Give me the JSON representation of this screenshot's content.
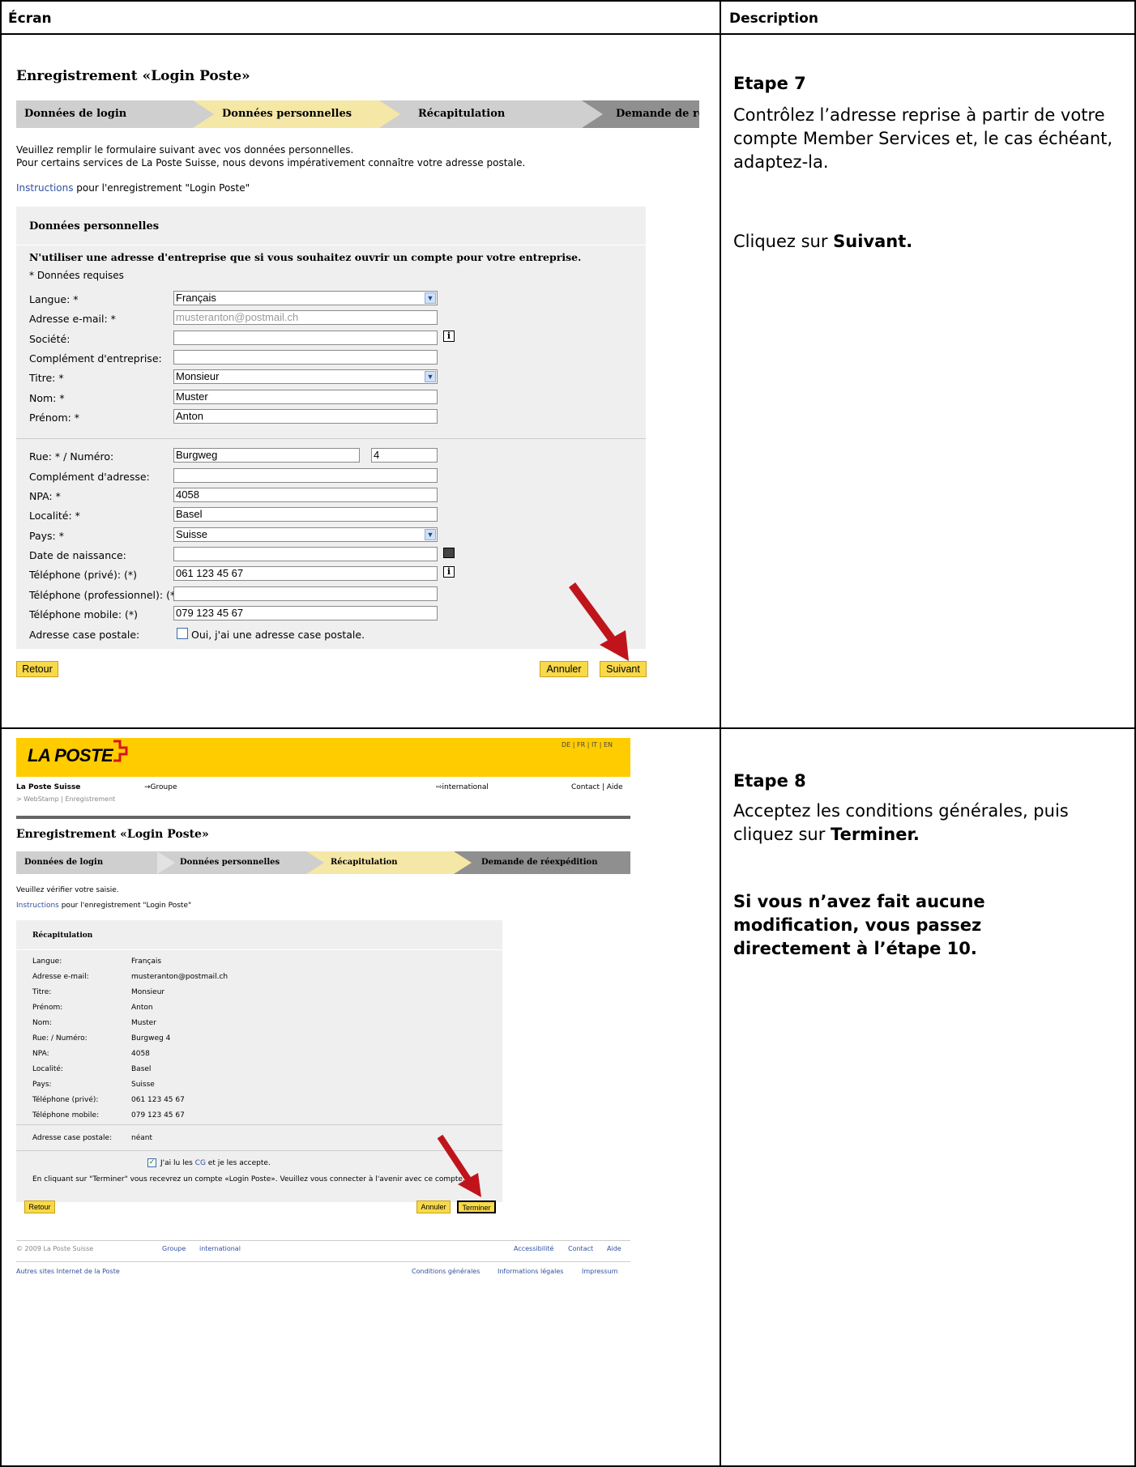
{
  "table": {
    "col_screen": "Écran",
    "col_description": "Description"
  },
  "step7": {
    "form_title": "Enregistrement «Login Poste»",
    "steps": [
      "Données de login",
      "Données personnelles",
      "Récapitulation",
      "Demande de réexpédition"
    ],
    "intro_line1": "Veuillez remplir le formulaire suivant avec vos données personnelles.",
    "intro_line2": "Pour certains services de La Poste Suisse, nous devons impérativement connaître votre adresse postale.",
    "instructions_link": "Instructions",
    "instructions_rest": " pour l'enregistrement \"Login Poste\"",
    "panel_title": "Données personnelles",
    "warning": "N'utiliser une adresse d'entreprise que si vous souhaitez ouvrir un compte pour votre entreprise.",
    "required_note": "* Données requises",
    "fields": [
      {
        "label": "Langue: *",
        "value": "Français"
      },
      {
        "label": "Adresse e-mail: *",
        "value": "musteranton@postmail.ch"
      },
      {
        "label": "Société:",
        "value": ""
      },
      {
        "label": "Complément d'entreprise:",
        "value": ""
      },
      {
        "label": "Titre: *",
        "value": "Monsieur"
      },
      {
        "label": "Nom: *",
        "value": "Muster"
      },
      {
        "label": "Prénom: *",
        "value": "Anton"
      }
    ],
    "address": [
      {
        "label": "Rue: * / Numéro:",
        "value": "Burgweg",
        "number": "4"
      },
      {
        "label": "Complément d'adresse:",
        "value": ""
      },
      {
        "label": "NPA: *",
        "value": "4058"
      },
      {
        "label": "Localité: *",
        "value": "Basel"
      },
      {
        "label": "Pays: *",
        "value": "Suisse"
      },
      {
        "label": "Date de naissance:",
        "value": ""
      },
      {
        "label": "Téléphone (privé): (*)",
        "value": "061 123 45 67"
      },
      {
        "label": "Téléphone (professionnel): (*)",
        "value": ""
      },
      {
        "label": "Téléphone mobile: (*)",
        "value": "079 123 45 67"
      },
      {
        "label": "Adresse case postale:",
        "value": "Oui, j'ai une adresse case postale."
      }
    ],
    "btn_back": "Retour",
    "btn_cancel": "Annuler",
    "btn_next": "Suivant",
    "desc_heading": "Etape 7",
    "desc_text": "Contrôlez l’adresse reprise à partir de votre compte Member Services et, le cas échéant, adaptez-la.",
    "desc_click_prefix": "Cliquez sur ",
    "desc_click_bold": "Suivant."
  },
  "step8": {
    "logo": "LA POSTE",
    "languages": "DE | FR | IT | EN",
    "nav_site": "La Poste Suisse",
    "nav_group": "→Groupe",
    "nav_international": "⇨international",
    "nav_contact": "Contact | Aide",
    "breadcrumb": "> WebStamp | Enregistrement",
    "form_title": "Enregistrement «Login Poste»",
    "steps": [
      "Données de login",
      "Données personnelles",
      "Récapitulation",
      "Demande de réexpédition"
    ],
    "verify": "Veuillez vérifier votre saisie.",
    "instructions_link": "Instructions",
    "instructions_rest": " pour l'enregistrement \"Login Poste\"",
    "panel_title": "Récapitulation",
    "rows": [
      {
        "label": "Langue:",
        "value": "Français"
      },
      {
        "label": "Adresse e-mail:",
        "value": "musteranton@postmail.ch"
      },
      {
        "label": "Titre:",
        "value": "Monsieur"
      },
      {
        "label": "Prénom:",
        "value": "Anton"
      },
      {
        "label": "Nom:",
        "value": "Muster"
      },
      {
        "label": "Rue: / Numéro:",
        "value": "Burgweg 4"
      },
      {
        "label": "NPA:",
        "value": "4058"
      },
      {
        "label": "Localité:",
        "value": "Basel"
      },
      {
        "label": "Pays:",
        "value": "Suisse"
      },
      {
        "label": "Téléphone (privé):",
        "value": "061 123 45 67"
      },
      {
        "label": "Téléphone mobile:",
        "value": "079 123 45 67"
      }
    ],
    "po_box_label": "Adresse case postale:",
    "po_box_value": "néant",
    "accept_prefix": "J'ai lu les ",
    "accept_link": "CG",
    "accept_suffix": " et je les accepte.",
    "notice": "En cliquant sur \"Terminer\" vous recevrez un compte «Login Poste». Veuillez vous connecter à l'avenir avec ce compte.",
    "btn_back": "Retour",
    "btn_cancel": "Annuler",
    "btn_finish": "Terminer",
    "footer_copy": "© 2009 La Poste Suisse",
    "footer_group": "Groupe",
    "footer_international": "international",
    "footer_access": "Accessibilité",
    "footer_contact": "Contact",
    "footer_help": "Aide",
    "footer_other": "Autres sites Internet de la Poste",
    "footer_terms": "Conditions générales",
    "footer_legal": "Informations légales",
    "footer_impressum": "Impressum",
    "desc_heading": "Etape 8",
    "desc_text_prefix": "Acceptez les conditions générales, puis cliquez sur ",
    "desc_text_bold": "Terminer.",
    "desc_note": "Si vous n’avez fait aucune modification, vous passez directement à l’étape 10."
  },
  "colors": {
    "accent_yellow": "#ffcc00",
    "button_yellow": "#f8d94a",
    "arrow_red": "#c0141c",
    "link_blue": "#3050a0"
  }
}
